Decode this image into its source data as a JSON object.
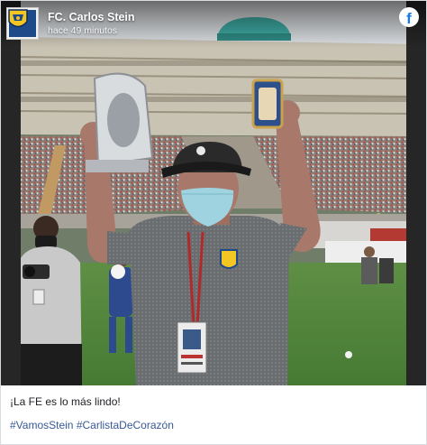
{
  "post": {
    "page_name": "FC. Carlos Stein",
    "time": "hace 49 minutos",
    "caption": "¡La FE es lo más lindo!",
    "hashtags": [
      "#VamosStein",
      "#CarlistaDeCorazón"
    ],
    "platform_icon": "facebook-icon",
    "avatar_icon": "club-crest-icon"
  },
  "colors": {
    "hashtag": "#385898",
    "facebook": "#1877f2",
    "crest_blue": "#1f4a8a",
    "crest_yellow": "#f3c623"
  }
}
